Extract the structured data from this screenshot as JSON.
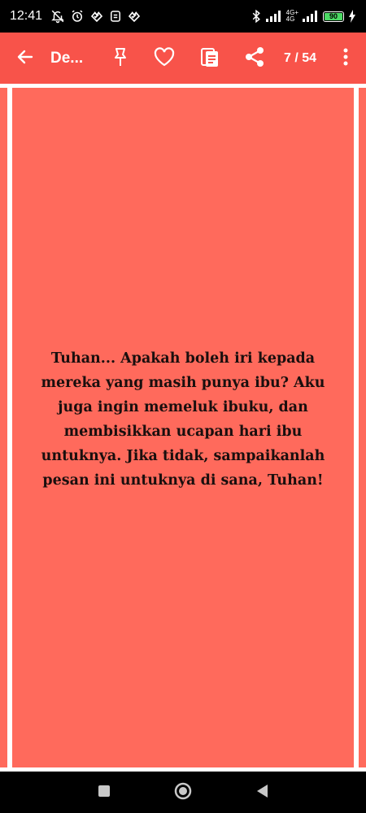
{
  "status_bar": {
    "time": "12:41",
    "network_top": "4G+",
    "network_bottom": "4G",
    "battery_level": "90",
    "icons": [
      "notifications-muted-icon",
      "alarm-icon",
      "app-notification-icon",
      "sim-icon",
      "app-notification-icon",
      "bluetooth-icon",
      "signal-icon",
      "signal-icon",
      "battery-icon",
      "charging-icon"
    ]
  },
  "toolbar": {
    "back_icon": "arrow-left-icon",
    "title": "De...",
    "pin_icon": "pin-icon",
    "favorite_icon": "heart-outline-icon",
    "copy_icon": "copy-document-icon",
    "share_icon": "share-icon",
    "counter": "7 / 54",
    "more_icon": "more-vertical-icon",
    "color": "#f8534a"
  },
  "card": {
    "background_color": "#ff6a5c",
    "quote": "Tuhan... Apakah boleh iri kepada mereka yang masih punya ibu? Aku juga ingin memeluk ibuku, dan membisikkan ucapan hari ibu untuknya. Jika tidak, sampaikanlah pesan ini untuknya di sana, Tuhan!"
  },
  "nav_bar": {
    "recents_icon": "square-icon",
    "home_icon": "circle-home-icon",
    "back_icon": "triangle-back-icon"
  }
}
